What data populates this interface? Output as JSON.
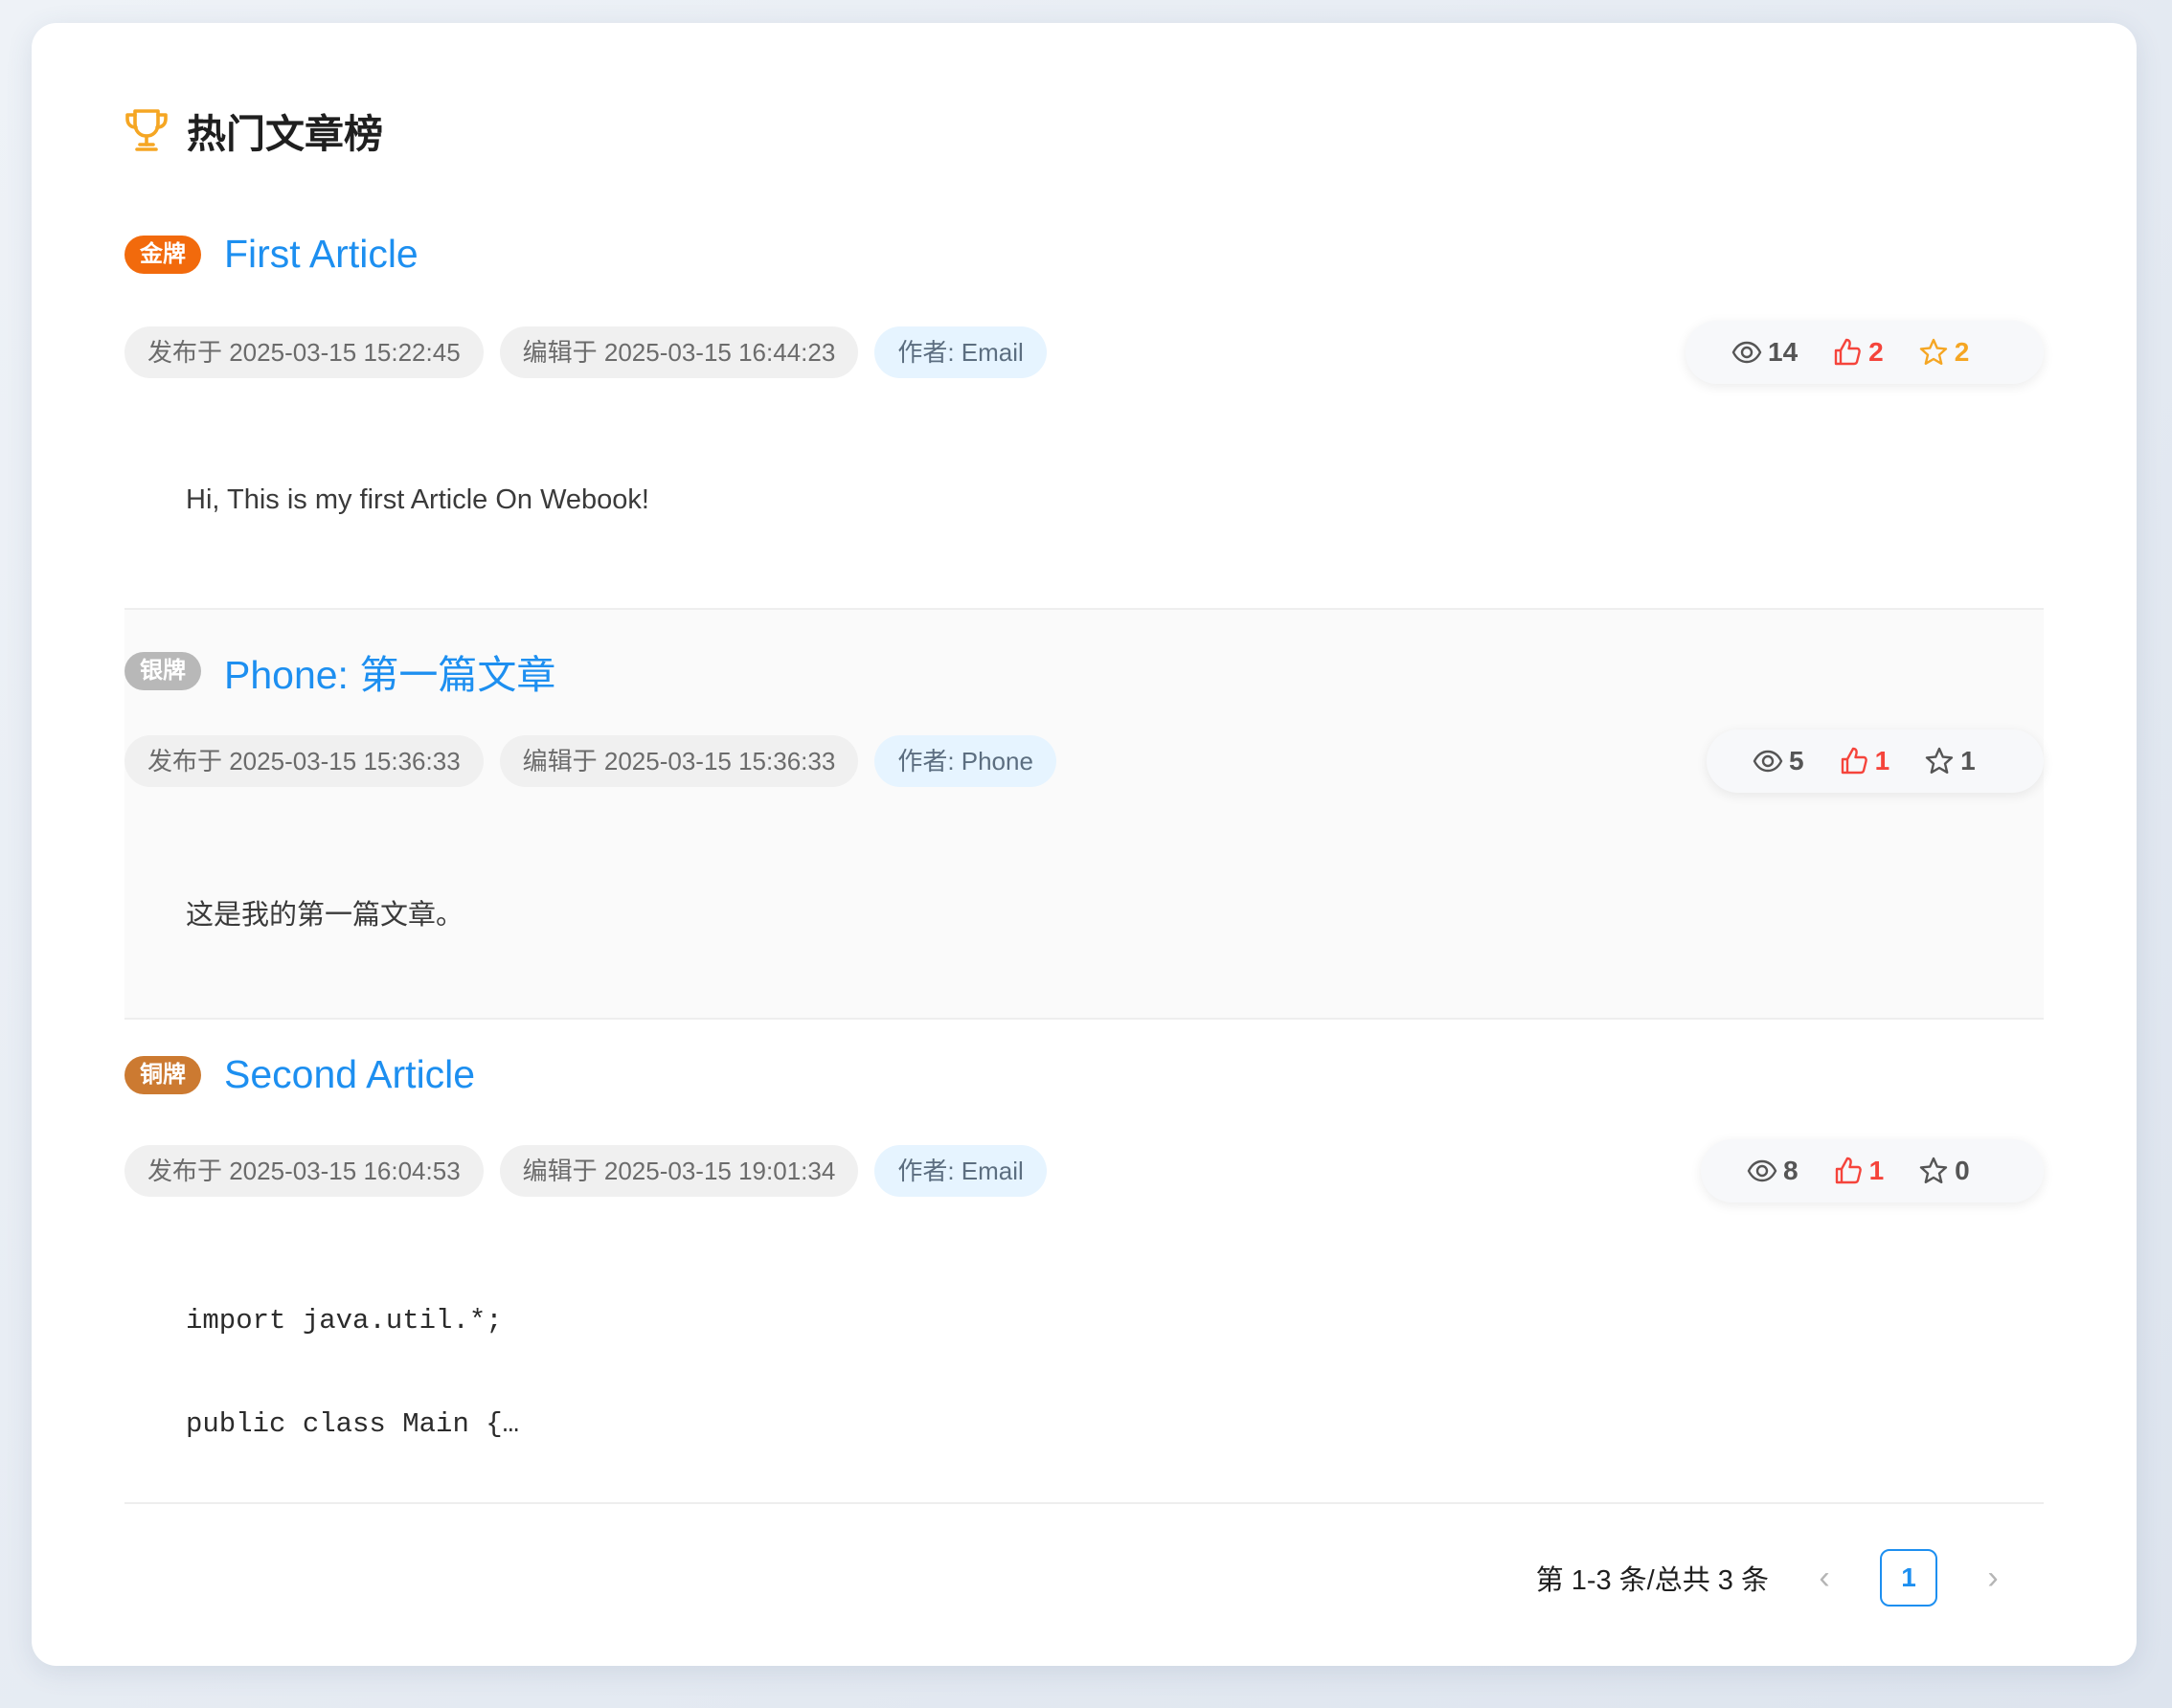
{
  "page": {
    "title": "热门文章榜",
    "title_icon": "trophy-icon"
  },
  "colors": {
    "gold": "#f26a0c",
    "silver": "#b8b8b8",
    "bronze": "#cc7a31",
    "link": "#1d8ff0",
    "like": "#f5443b",
    "favorite_active": "#f5a623"
  },
  "articles": [
    {
      "rank_badge": "金牌",
      "title": "First Article",
      "published": "发布于 2025-03-15 15:22:45",
      "edited": "编辑于 2025-03-15 16:44:23",
      "author": "作者: Email",
      "views": "14",
      "likes": "2",
      "favorites": "2",
      "excerpt": "Hi, This is my first Article On Webook!"
    },
    {
      "rank_badge": "银牌",
      "title": "Phone: 第一篇文章",
      "published": "发布于 2025-03-15 15:36:33",
      "edited": "编辑于 2025-03-15 15:36:33",
      "author": "作者: Phone",
      "views": "5",
      "likes": "1",
      "favorites": "1",
      "excerpt": "这是我的第一篇文章。"
    },
    {
      "rank_badge": "铜牌",
      "title": "Second Article",
      "published": "发布于 2025-03-15 16:04:53",
      "edited": "编辑于 2025-03-15 19:01:34",
      "author": "作者: Email",
      "views": "8",
      "likes": "1",
      "favorites": "0",
      "excerpt_line1": "import java.util.*;",
      "excerpt_line2": "public class Main {…"
    }
  ],
  "pagination": {
    "total_text": "第 1-3 条/总共 3 条",
    "current_page": "1",
    "prev": "‹",
    "next": "›"
  }
}
